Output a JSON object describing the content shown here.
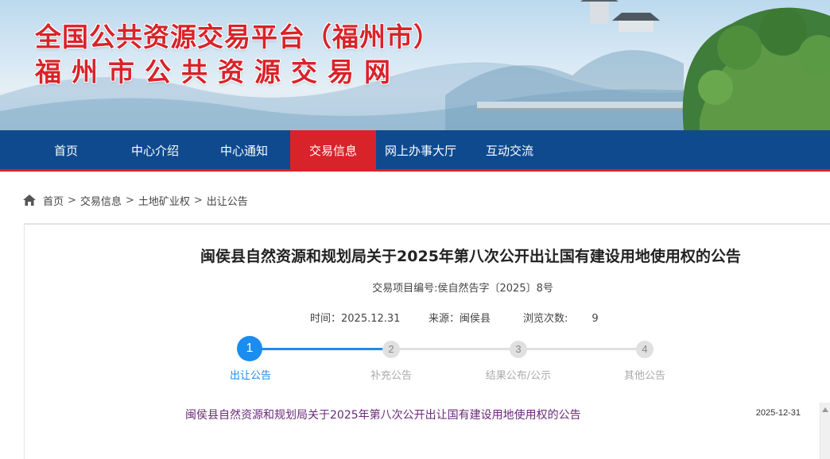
{
  "banner": {
    "title_line1": "全国公共资源交易平台（福州市）",
    "title_line2": "福州市公共资源交易网"
  },
  "nav": {
    "items": [
      {
        "label": "首页"
      },
      {
        "label": "中心介绍"
      },
      {
        "label": "中心通知"
      },
      {
        "label": "交易信息"
      },
      {
        "label": "网上办事大厅"
      },
      {
        "label": "互动交流"
      }
    ],
    "active_label": "交易信息"
  },
  "breadcrumb": {
    "items": [
      "首页",
      "交易信息",
      "土地矿业权",
      "出让公告"
    ],
    "separator": ">"
  },
  "article": {
    "title": "闽侯县自然资源和规划局关于2025年第八次公开出让国有建设用地使用权的公告",
    "project_no": "交易项目编号:侯自然告字〔2025〕8号",
    "time_label": "时间：",
    "time_value": "2025.12.31",
    "source_label": "来源：",
    "source_value": "闽侯县",
    "views_label": "浏览次数:",
    "views_value": "9"
  },
  "steps": [
    {
      "number": "1",
      "label": "出让公告",
      "active": true
    },
    {
      "number": "2",
      "label": "补充公告",
      "active": false
    },
    {
      "number": "3",
      "label": "结果公布/公示",
      "active": false
    },
    {
      "number": "4",
      "label": "其他公告",
      "active": false
    }
  ],
  "list": {
    "items": [
      {
        "title": "闽侯县自然资源和规划局关于2025年第八次公开出让国有建设用地使用权的公告",
        "date": "2025-12-31"
      }
    ]
  },
  "colors": {
    "brand_red": "#d8232a",
    "nav_blue": "#0f4a8f",
    "step_blue": "#1b8cf0"
  }
}
